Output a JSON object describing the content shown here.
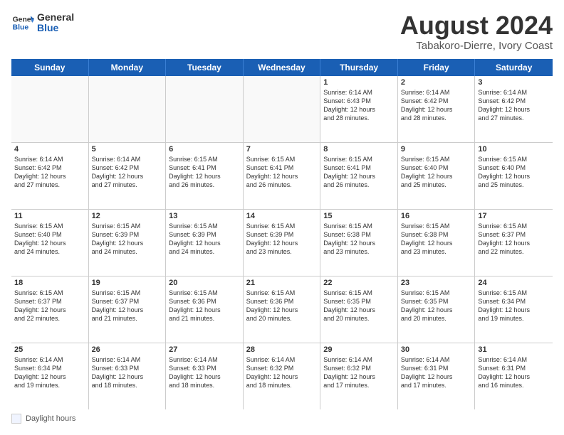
{
  "logo": {
    "general": "General",
    "blue": "Blue"
  },
  "header": {
    "month_year": "August 2024",
    "location": "Tabakoro-Dierre, Ivory Coast"
  },
  "days_of_week": [
    "Sunday",
    "Monday",
    "Tuesday",
    "Wednesday",
    "Thursday",
    "Friday",
    "Saturday"
  ],
  "footer": {
    "label": "Daylight hours"
  },
  "weeks": [
    {
      "cells": [
        {
          "day": "",
          "content": ""
        },
        {
          "day": "",
          "content": ""
        },
        {
          "day": "",
          "content": ""
        },
        {
          "day": "",
          "content": ""
        },
        {
          "day": "1",
          "content": "Sunrise: 6:14 AM\nSunset: 6:43 PM\nDaylight: 12 hours\nand 28 minutes."
        },
        {
          "day": "2",
          "content": "Sunrise: 6:14 AM\nSunset: 6:42 PM\nDaylight: 12 hours\nand 28 minutes."
        },
        {
          "day": "3",
          "content": "Sunrise: 6:14 AM\nSunset: 6:42 PM\nDaylight: 12 hours\nand 27 minutes."
        }
      ]
    },
    {
      "cells": [
        {
          "day": "4",
          "content": "Sunrise: 6:14 AM\nSunset: 6:42 PM\nDaylight: 12 hours\nand 27 minutes."
        },
        {
          "day": "5",
          "content": "Sunrise: 6:14 AM\nSunset: 6:42 PM\nDaylight: 12 hours\nand 27 minutes."
        },
        {
          "day": "6",
          "content": "Sunrise: 6:15 AM\nSunset: 6:41 PM\nDaylight: 12 hours\nand 26 minutes."
        },
        {
          "day": "7",
          "content": "Sunrise: 6:15 AM\nSunset: 6:41 PM\nDaylight: 12 hours\nand 26 minutes."
        },
        {
          "day": "8",
          "content": "Sunrise: 6:15 AM\nSunset: 6:41 PM\nDaylight: 12 hours\nand 26 minutes."
        },
        {
          "day": "9",
          "content": "Sunrise: 6:15 AM\nSunset: 6:40 PM\nDaylight: 12 hours\nand 25 minutes."
        },
        {
          "day": "10",
          "content": "Sunrise: 6:15 AM\nSunset: 6:40 PM\nDaylight: 12 hours\nand 25 minutes."
        }
      ]
    },
    {
      "cells": [
        {
          "day": "11",
          "content": "Sunrise: 6:15 AM\nSunset: 6:40 PM\nDaylight: 12 hours\nand 24 minutes."
        },
        {
          "day": "12",
          "content": "Sunrise: 6:15 AM\nSunset: 6:39 PM\nDaylight: 12 hours\nand 24 minutes."
        },
        {
          "day": "13",
          "content": "Sunrise: 6:15 AM\nSunset: 6:39 PM\nDaylight: 12 hours\nand 24 minutes."
        },
        {
          "day": "14",
          "content": "Sunrise: 6:15 AM\nSunset: 6:39 PM\nDaylight: 12 hours\nand 23 minutes."
        },
        {
          "day": "15",
          "content": "Sunrise: 6:15 AM\nSunset: 6:38 PM\nDaylight: 12 hours\nand 23 minutes."
        },
        {
          "day": "16",
          "content": "Sunrise: 6:15 AM\nSunset: 6:38 PM\nDaylight: 12 hours\nand 23 minutes."
        },
        {
          "day": "17",
          "content": "Sunrise: 6:15 AM\nSunset: 6:37 PM\nDaylight: 12 hours\nand 22 minutes."
        }
      ]
    },
    {
      "cells": [
        {
          "day": "18",
          "content": "Sunrise: 6:15 AM\nSunset: 6:37 PM\nDaylight: 12 hours\nand 22 minutes."
        },
        {
          "day": "19",
          "content": "Sunrise: 6:15 AM\nSunset: 6:37 PM\nDaylight: 12 hours\nand 21 minutes."
        },
        {
          "day": "20",
          "content": "Sunrise: 6:15 AM\nSunset: 6:36 PM\nDaylight: 12 hours\nand 21 minutes."
        },
        {
          "day": "21",
          "content": "Sunrise: 6:15 AM\nSunset: 6:36 PM\nDaylight: 12 hours\nand 20 minutes."
        },
        {
          "day": "22",
          "content": "Sunrise: 6:15 AM\nSunset: 6:35 PM\nDaylight: 12 hours\nand 20 minutes."
        },
        {
          "day": "23",
          "content": "Sunrise: 6:15 AM\nSunset: 6:35 PM\nDaylight: 12 hours\nand 20 minutes."
        },
        {
          "day": "24",
          "content": "Sunrise: 6:15 AM\nSunset: 6:34 PM\nDaylight: 12 hours\nand 19 minutes."
        }
      ]
    },
    {
      "cells": [
        {
          "day": "25",
          "content": "Sunrise: 6:14 AM\nSunset: 6:34 PM\nDaylight: 12 hours\nand 19 minutes."
        },
        {
          "day": "26",
          "content": "Sunrise: 6:14 AM\nSunset: 6:33 PM\nDaylight: 12 hours\nand 18 minutes."
        },
        {
          "day": "27",
          "content": "Sunrise: 6:14 AM\nSunset: 6:33 PM\nDaylight: 12 hours\nand 18 minutes."
        },
        {
          "day": "28",
          "content": "Sunrise: 6:14 AM\nSunset: 6:32 PM\nDaylight: 12 hours\nand 18 minutes."
        },
        {
          "day": "29",
          "content": "Sunrise: 6:14 AM\nSunset: 6:32 PM\nDaylight: 12 hours\nand 17 minutes."
        },
        {
          "day": "30",
          "content": "Sunrise: 6:14 AM\nSunset: 6:31 PM\nDaylight: 12 hours\nand 17 minutes."
        },
        {
          "day": "31",
          "content": "Sunrise: 6:14 AM\nSunset: 6:31 PM\nDaylight: 12 hours\nand 16 minutes."
        }
      ]
    }
  ]
}
